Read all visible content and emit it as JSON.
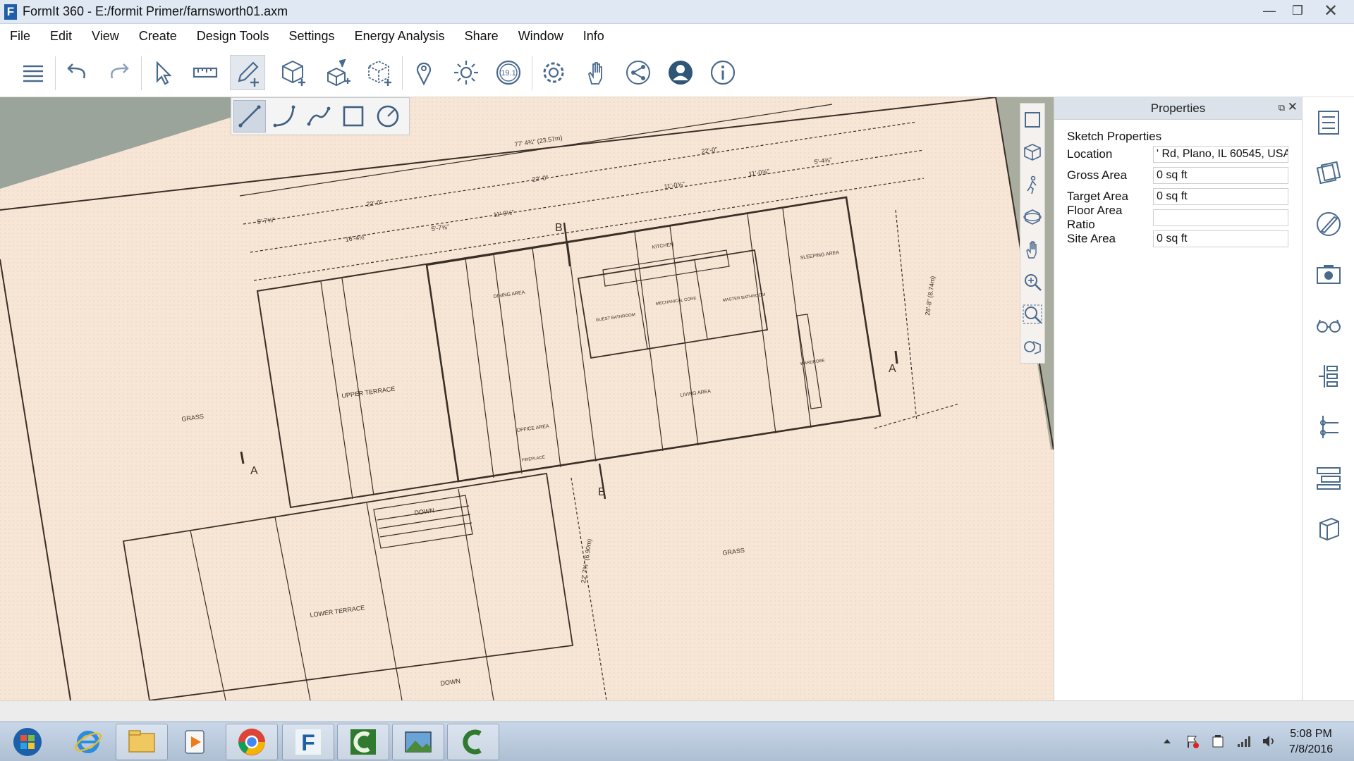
{
  "window": {
    "title": "FormIt 360 - E:/formit Primer/farnsworth01.axm",
    "logo_letter": "F",
    "minimize": "—",
    "restore": "❐",
    "close": "✕"
  },
  "menu": [
    "File",
    "Edit",
    "View",
    "Create",
    "Design Tools",
    "Settings",
    "Energy Analysis",
    "Share",
    "Window",
    "Info"
  ],
  "toolbar": {
    "tools": [
      "layers-icon",
      "undo-icon",
      "redo-icon",
      "select-icon",
      "measure-icon",
      "sketch-pencil-icon",
      "cube-add-icon",
      "push-pull-icon",
      "group-add-icon",
      "location-pin-icon",
      "sun-icon",
      "version-badge-icon",
      "settings-gear-icon",
      "gesture-hand-icon",
      "share-icon",
      "user-icon",
      "info-icon"
    ],
    "version_badge": "19.1",
    "active_tool": "sketch-pencil-icon"
  },
  "sketch_flyout": {
    "tools": [
      "line-icon",
      "arc-icon",
      "spline-icon",
      "rectangle-icon",
      "circle-icon"
    ],
    "active_tool": "line-icon"
  },
  "plan": {
    "labels": {
      "grass1": "GRASS",
      "grass2": "GRASS",
      "upper_terrace": "UPPER TERRACE",
      "lower_terrace": "LOWER TERRACE",
      "down1": "DOWN",
      "down2": "DOWN",
      "kitchen": "KITCHEN",
      "dining": "DINING AREA",
      "living": "LIVING AREA",
      "office": "OFFICE AREA",
      "sleeping": "SLEEPING AREA",
      "mechanical": "MECHANICAL CORE",
      "guest_bath": "GUEST BATHROOM",
      "master_bath": "MASTER BATHROOM",
      "wardrobe": "WARDROBE",
      "fireplace": "FIREPLACE",
      "section_a": "A",
      "section_b": "B",
      "dim_top": "77' 4¾\" (23.57m)",
      "dim_22": "22'-0\"",
      "dim_22b": "22'-0\"",
      "dim_22c": "22'-0\"",
      "dim_11": "11'-0½\"",
      "dim_11b": "11'-0⅝\"",
      "dim_11c": "11'-0⅝\"",
      "dim_5": "5'-7⅝\"",
      "dim_5b": "5'-4⅜\"",
      "dim_16": "16'-4½\"",
      "dim_5c": "5'-7⅜\"",
      "dim_vert": "22' 7¾\" (6.90m)",
      "dim_vert2": "28'-8\" (8.74m)"
    }
  },
  "nav_tools": [
    "zoom-extents-icon",
    "view-cube-icon",
    "walk-icon",
    "orbit-icon",
    "pan-hand-icon",
    "zoom-in-icon",
    "zoom-window-icon",
    "look-icon"
  ],
  "properties": {
    "header": "Properties",
    "section": "Sketch Properties",
    "rows": [
      {
        "label": "Location",
        "value": "' Rd, Plano, IL 60545, USA"
      },
      {
        "label": "Gross Area",
        "value": "0 sq ft"
      },
      {
        "label": "Target Area",
        "value": "0 sq ft"
      },
      {
        "label": "Floor Area Ratio",
        "value": ""
      },
      {
        "label": "Site Area",
        "value": "0 sq ft"
      }
    ]
  },
  "dock_tools": [
    "properties-panel-icon",
    "materials-icon",
    "style-brush-icon",
    "scenes-camera-icon",
    "visual-styles-glasses-icon",
    "levels-icon",
    "layers-panel-icon",
    "groups-icon",
    "content-library-icon"
  ],
  "taskbar": {
    "apps": [
      "start-orb-icon",
      "internet-explorer-icon",
      "file-explorer-icon",
      "media-player-icon",
      "chrome-icon",
      "formit-icon",
      "camtasia-icon",
      "photos-icon",
      "camtasia-recorder-icon"
    ],
    "time": "5:08 PM",
    "date": "7/8/2016"
  }
}
